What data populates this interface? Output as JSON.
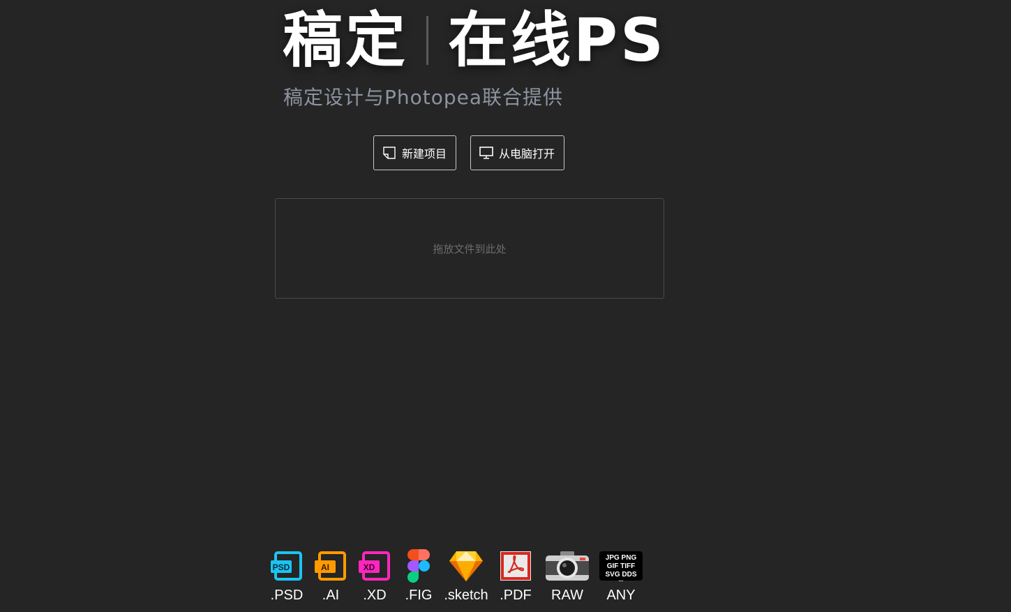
{
  "hero": {
    "brand": "稿定",
    "product": "在线PS",
    "subtitle": "稿定设计与Photopea联合提供"
  },
  "actions": {
    "new_project": "新建项目",
    "open_from_computer": "从电脑打开"
  },
  "dropzone": {
    "label": "拖放文件到此处"
  },
  "formats": [
    {
      "label": ".PSD",
      "icon": "psd-icon",
      "badge": "PSD",
      "color": "#1ac5f2"
    },
    {
      "label": ".AI",
      "icon": "ai-icon",
      "badge": "AI",
      "color": "#ff9a00"
    },
    {
      "label": ".XD",
      "icon": "xd-icon",
      "badge": "XD",
      "color": "#ff26be"
    },
    {
      "label": ".FIG",
      "icon": "figma-icon"
    },
    {
      "label": ".sketch",
      "icon": "sketch-icon"
    },
    {
      "label": ".PDF",
      "icon": "pdf-icon"
    },
    {
      "label": "RAW",
      "icon": "camera-icon"
    },
    {
      "label": "ANY",
      "icon": "image-formats-icon",
      "badge_lines": [
        "JPG PNG",
        "GIF TIFF",
        "SVG DDS",
        "..."
      ]
    }
  ],
  "colors": {
    "background": "#252525",
    "subtitle": "#8d94a1",
    "dropzone_text": "#6c6c6c"
  }
}
